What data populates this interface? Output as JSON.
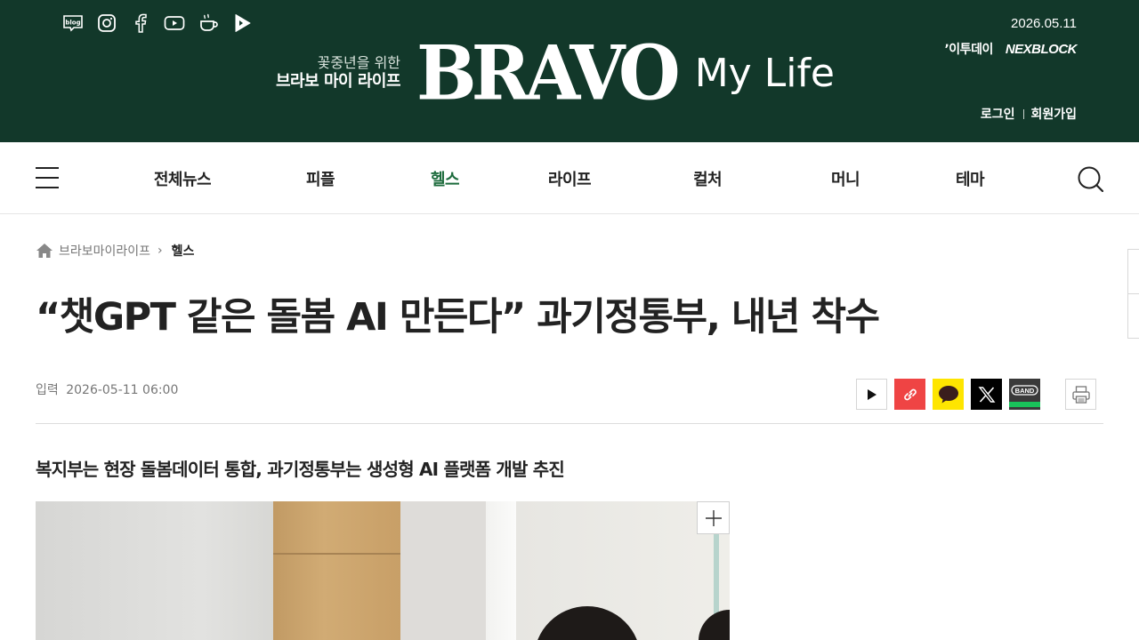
{
  "header": {
    "sns": [
      "blog-icon",
      "instagram-icon",
      "facebook-icon",
      "youtube-icon",
      "kakao-story-icon",
      "play-icon"
    ],
    "date": "2026.05.11",
    "partners": {
      "etoday": "ʼ이투데이",
      "nexblock": "NEXBLOCK"
    },
    "auth": {
      "login": "로그인",
      "signup": "회원가입"
    },
    "brand": {
      "tagline_sub": "꽃중년을 위한",
      "tagline_main": "브라보 마이 라이프",
      "logo": "BRAVO",
      "logo_suffix": "My Life"
    },
    "bg_color": "#12382a"
  },
  "nav": {
    "items": [
      {
        "label": "전체뉴스",
        "active": false
      },
      {
        "label": "피플",
        "active": false
      },
      {
        "label": "헬스",
        "active": true
      },
      {
        "label": "라이프",
        "active": false
      },
      {
        "label": "컬처",
        "active": false
      },
      {
        "label": "머니",
        "active": false
      },
      {
        "label": "테마",
        "active": false
      }
    ],
    "active_color": "#1c6b3c"
  },
  "breadcrumb": {
    "home": "브라보마이라이프",
    "current": "헬스"
  },
  "article": {
    "headline": "“챗GPT 같은 돌봄 AI 만든다” 과기정통부, 내년 착수",
    "meta_label": "입력",
    "meta_datetime": "2026-05-11 06:00",
    "subtitle": "복지부는 현장 돌봄데이터 통합, 과기정통부는 생성형 AI 플랫폼 개발 추진",
    "share_buttons": [
      "play-icon",
      "link-icon",
      "kakao-icon",
      "x-icon",
      "band-icon"
    ],
    "share_band_label": "BAND",
    "print_icon": "printer-icon"
  }
}
